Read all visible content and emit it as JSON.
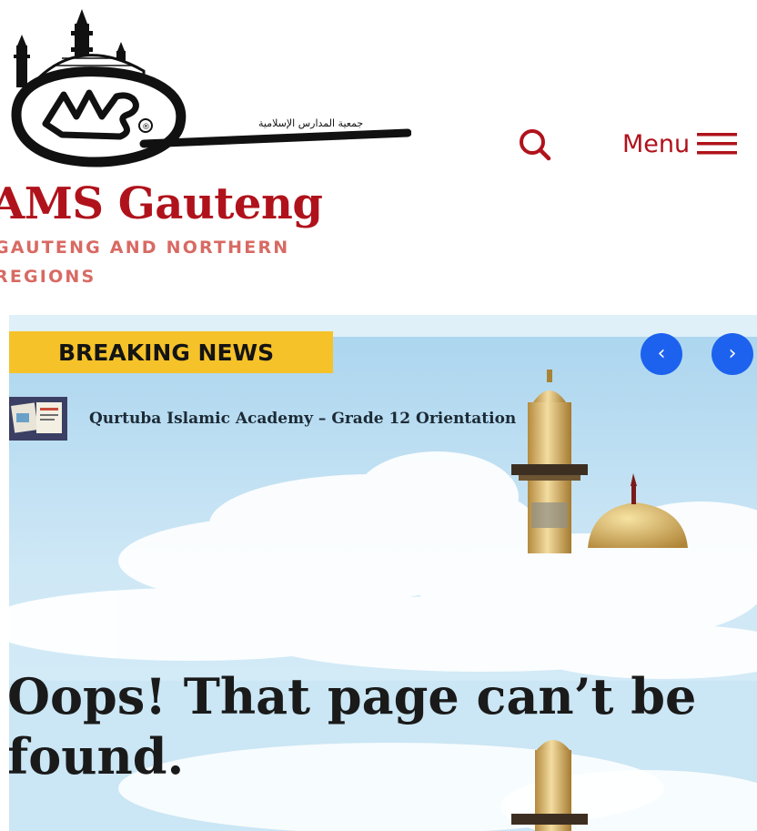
{
  "header": {
    "logo_text": "AMS",
    "logo_arabic": "جمعية المدارس الإسلامية",
    "logo_registered": "®",
    "search_icon": "search-icon",
    "menu_label": "Menu",
    "menu_icon": "hamburger-icon"
  },
  "site": {
    "title": "AMS Gauteng",
    "description": "GAUTENG AND NORTHERN REGIONS"
  },
  "breaking_news": {
    "label": "BREAKING NEWS",
    "prev_icon": "chevron-left-icon",
    "next_icon": "chevron-right-icon",
    "prev_label": "‹",
    "next_label": "›",
    "item_title": "Qurtuba Islamic Academy – Grade 12 Orientation"
  },
  "error": {
    "heading": "Oops! That page can’t be found."
  },
  "colors": {
    "brand_red": "#b0121b",
    "description_red": "#d86a63",
    "badge_yellow": "#f6c22a",
    "nav_blue": "#1c62ee",
    "sky_blue": "#bfe0f2"
  }
}
